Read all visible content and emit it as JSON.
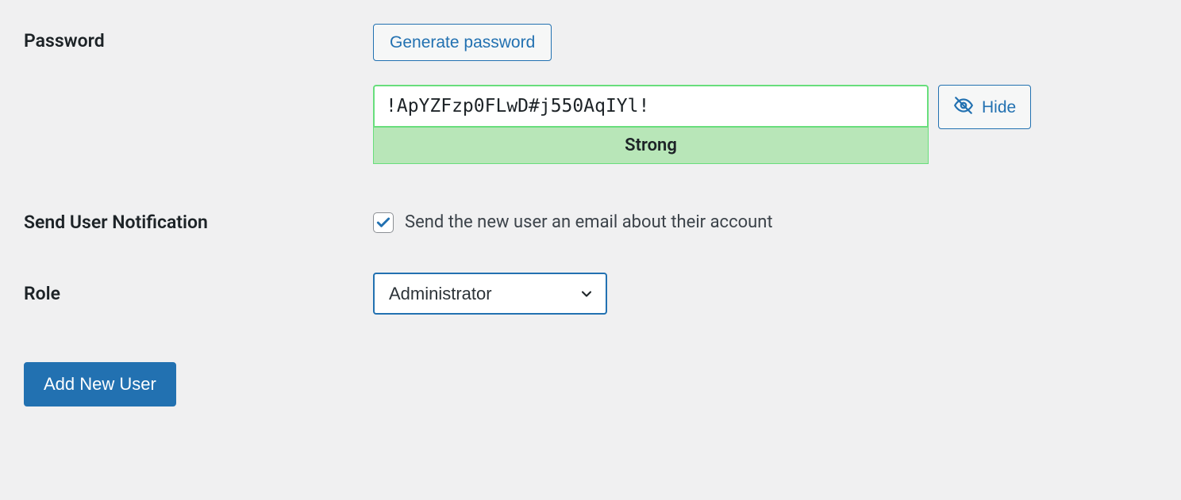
{
  "password": {
    "label": "Password",
    "generate_button": "Generate password",
    "value": "!ApYZFzp0FLwD#j550AqIYl!",
    "strength": "Strong",
    "hide_button": "Hide"
  },
  "notification": {
    "label": "Send User Notification",
    "checkbox_label": "Send the new user an email about their account",
    "checked": true
  },
  "role": {
    "label": "Role",
    "selected": "Administrator"
  },
  "submit": {
    "label": "Add New User"
  }
}
